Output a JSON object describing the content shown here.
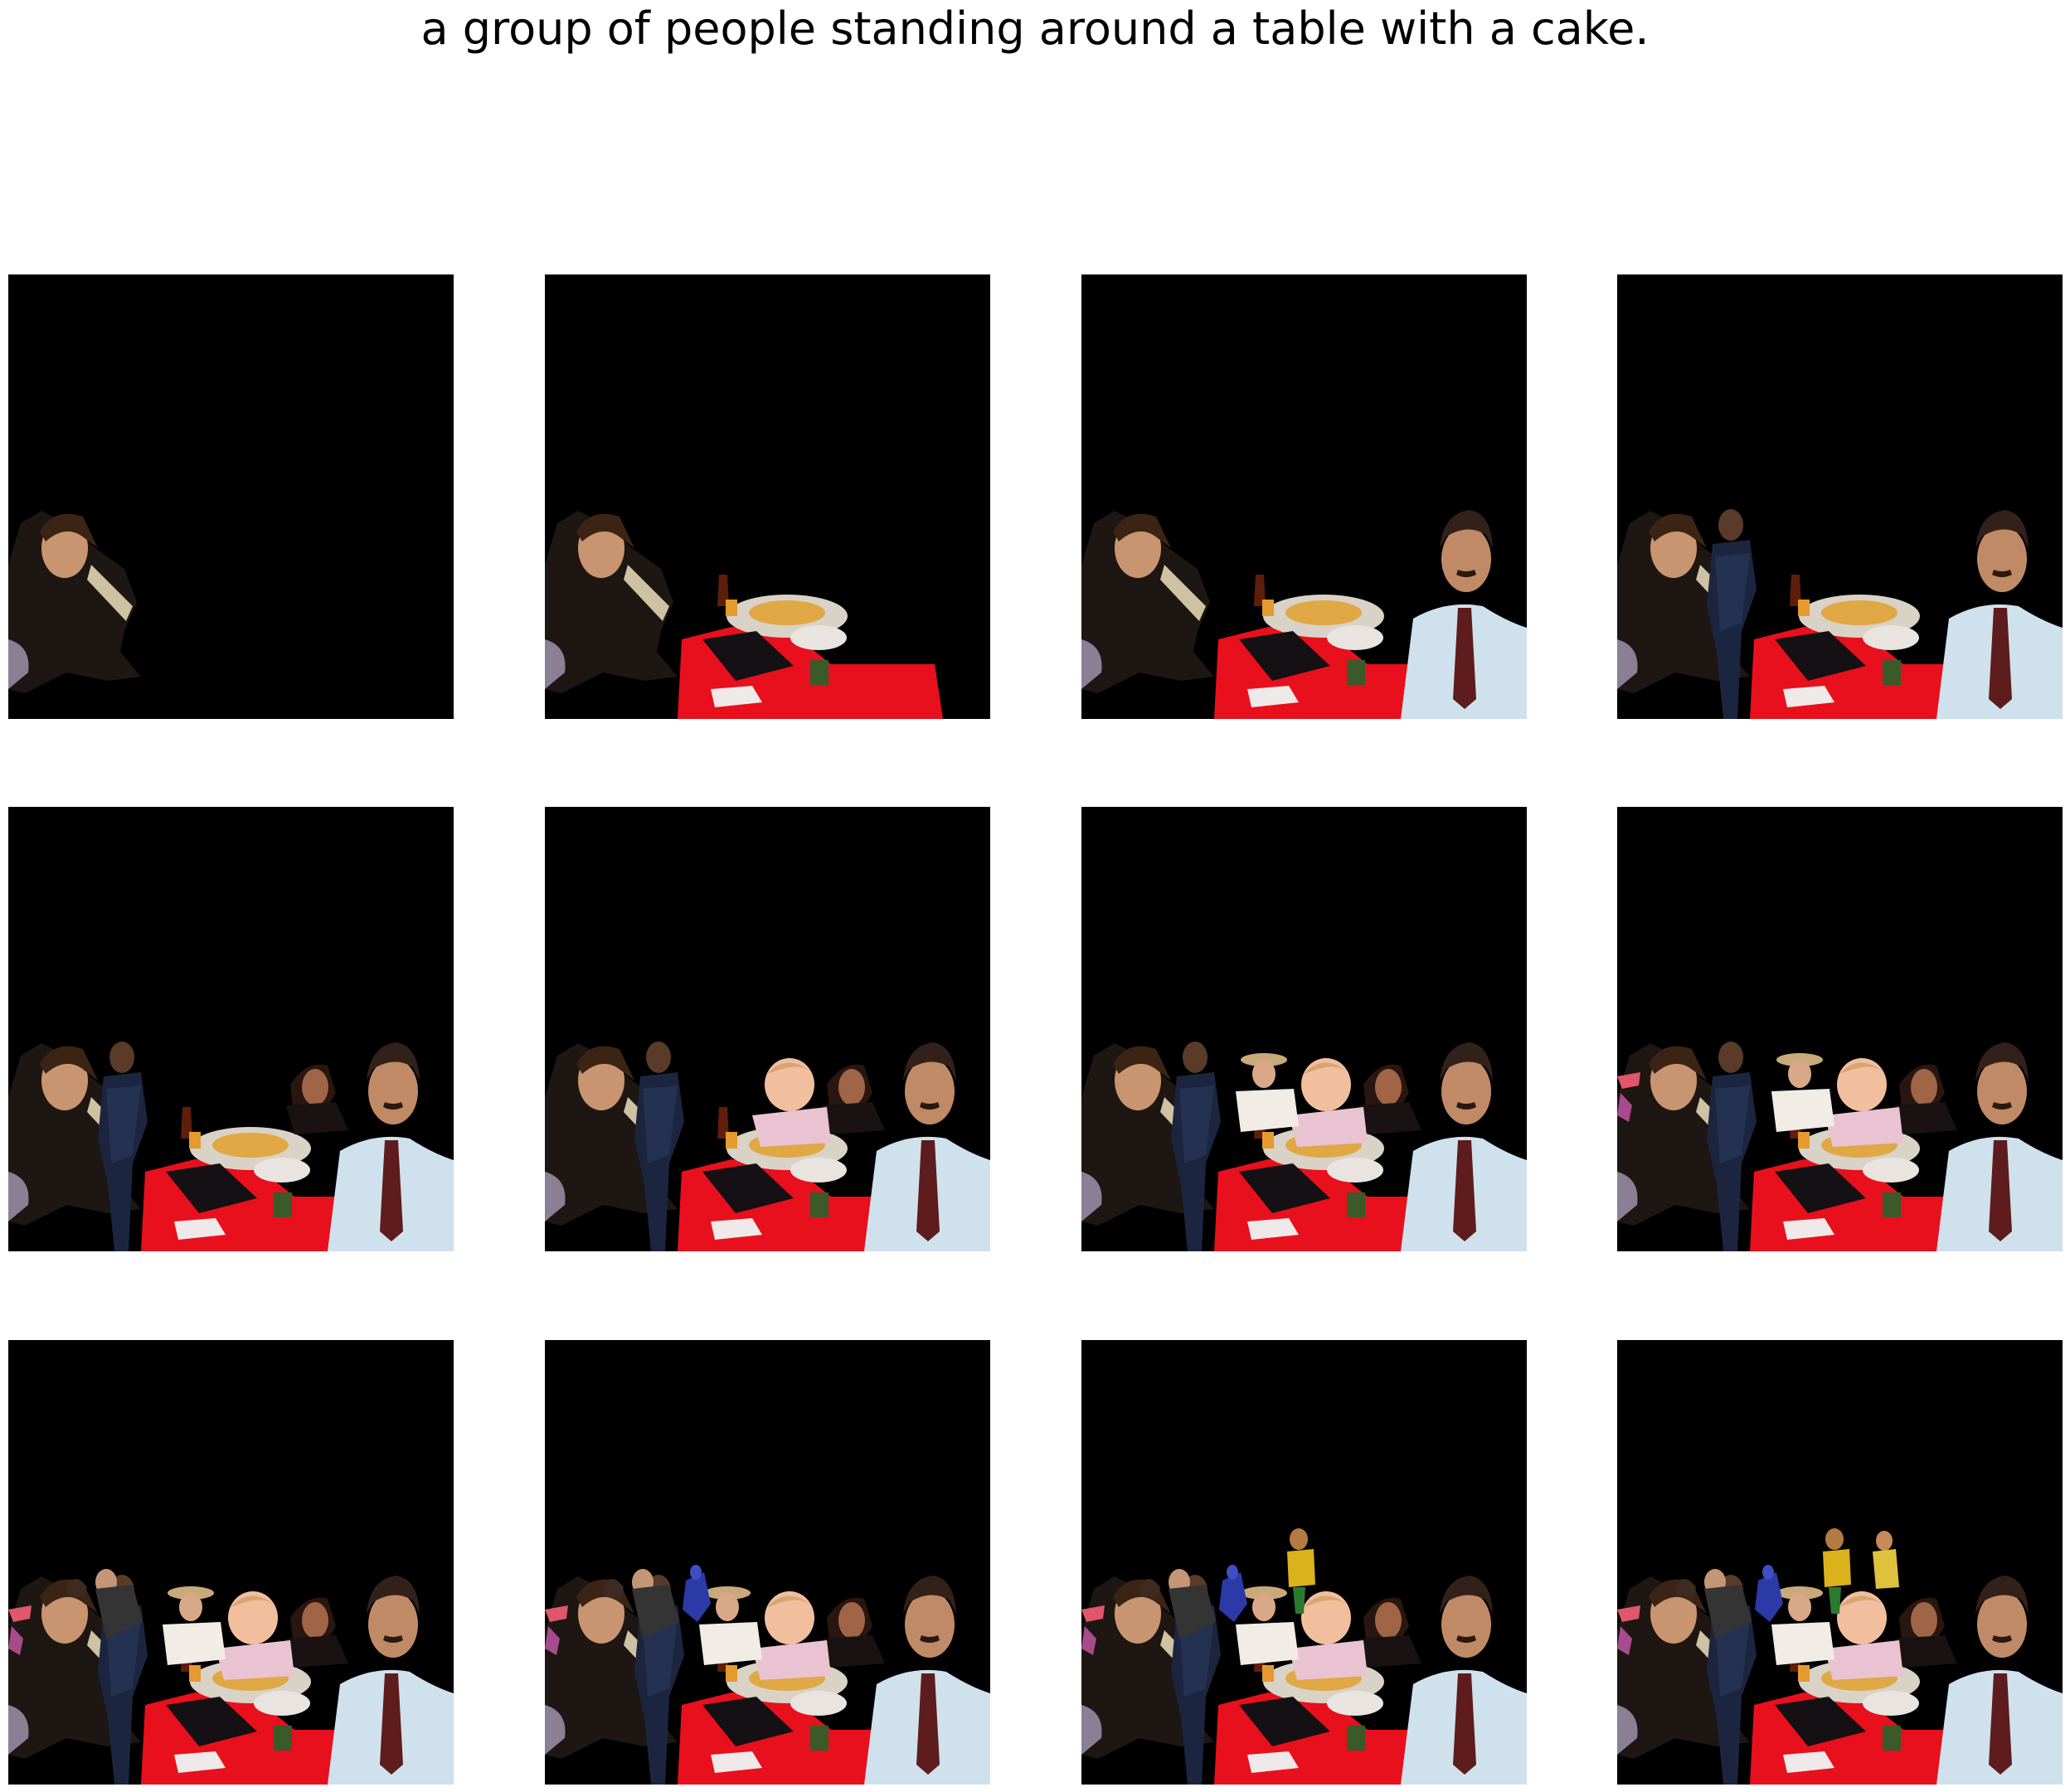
{
  "caption": "a group of people standing around a table with a cake.",
  "background_color": "#000000",
  "layer_order": [
    "girl-left",
    "table-pizza",
    "man-tie",
    "man-navy",
    "woman-dark-hair",
    "baby",
    "woman-hat",
    "pink-object",
    "man-glasses",
    "blue-figure",
    "yellow-figure",
    "toddler-yellow"
  ],
  "panels": [
    {
      "step": 1,
      "layers": [
        "girl-left"
      ]
    },
    {
      "step": 2,
      "layers": [
        "girl-left",
        "table-pizza"
      ]
    },
    {
      "step": 3,
      "layers": [
        "girl-left",
        "table-pizza",
        "man-tie"
      ]
    },
    {
      "step": 4,
      "layers": [
        "girl-left",
        "table-pizza",
        "man-tie",
        "man-navy"
      ]
    },
    {
      "step": 5,
      "layers": [
        "girl-left",
        "table-pizza",
        "man-tie",
        "man-navy",
        "woman-dark-hair"
      ]
    },
    {
      "step": 6,
      "layers": [
        "girl-left",
        "table-pizza",
        "man-tie",
        "man-navy",
        "woman-dark-hair",
        "baby"
      ]
    },
    {
      "step": 7,
      "layers": [
        "girl-left",
        "table-pizza",
        "man-tie",
        "man-navy",
        "woman-dark-hair",
        "baby",
        "woman-hat"
      ]
    },
    {
      "step": 8,
      "layers": [
        "girl-left",
        "table-pizza",
        "man-tie",
        "man-navy",
        "woman-dark-hair",
        "baby",
        "woman-hat",
        "pink-object"
      ]
    },
    {
      "step": 9,
      "layers": [
        "girl-left",
        "table-pizza",
        "man-tie",
        "man-navy",
        "woman-dark-hair",
        "baby",
        "woman-hat",
        "pink-object",
        "man-glasses"
      ]
    },
    {
      "step": 10,
      "layers": [
        "girl-left",
        "table-pizza",
        "man-tie",
        "man-navy",
        "woman-dark-hair",
        "baby",
        "woman-hat",
        "pink-object",
        "man-glasses",
        "blue-figure"
      ]
    },
    {
      "step": 11,
      "layers": [
        "girl-left",
        "table-pizza",
        "man-tie",
        "man-navy",
        "woman-dark-hair",
        "baby",
        "woman-hat",
        "pink-object",
        "man-glasses",
        "blue-figure",
        "yellow-figure"
      ]
    },
    {
      "step": 12,
      "layers": [
        "girl-left",
        "table-pizza",
        "man-tie",
        "man-navy",
        "woman-dark-hair",
        "baby",
        "woman-hat",
        "pink-object",
        "man-glasses",
        "blue-figure",
        "yellow-figure",
        "toddler-yellow"
      ]
    }
  ]
}
